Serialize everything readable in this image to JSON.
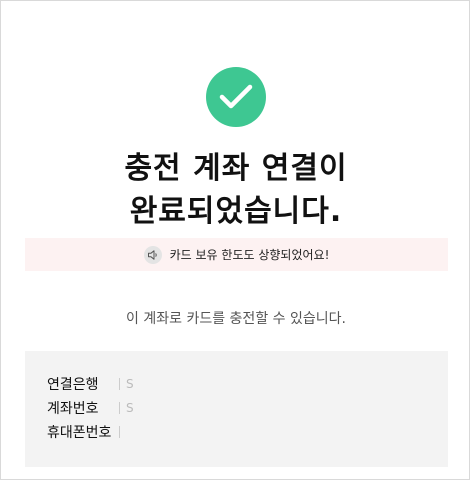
{
  "success": {
    "icon": "checkmark-icon",
    "color": "#3ec792",
    "title_line1": "충전 계좌 연결이",
    "title_line2": "완료되었습니다."
  },
  "notice": {
    "icon": "speaker-icon",
    "text": "카드 보유 한도도 상향되었어요!"
  },
  "subtitle": "이 계좌로 카드를 충전할 수 있습니다.",
  "info": {
    "rows": [
      {
        "label": "연결은행",
        "value": "S"
      },
      {
        "label": "계좌번호",
        "value": "S"
      },
      {
        "label": "휴대폰번호",
        "value": ""
      }
    ]
  }
}
